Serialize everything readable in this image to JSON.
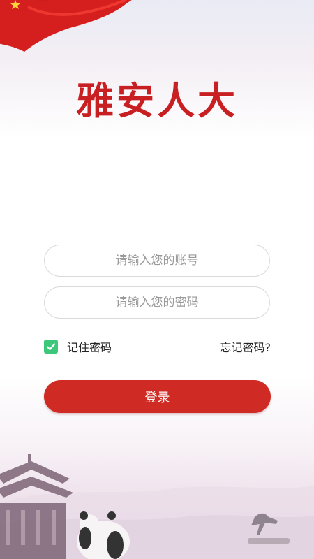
{
  "app": {
    "title": "雅安人大"
  },
  "login_form": {
    "account_placeholder": "请输入您的账号",
    "password_placeholder": "请输入您的密码",
    "remember_label": "记住密码",
    "remember_checked": true,
    "forgot_label": "忘记密码?",
    "submit_label": "登录"
  },
  "colors": {
    "brand_red": "#cf2a24",
    "checkbox_green": "#3cc77a"
  },
  "icons": [
    "flag-icon",
    "check-icon"
  ]
}
